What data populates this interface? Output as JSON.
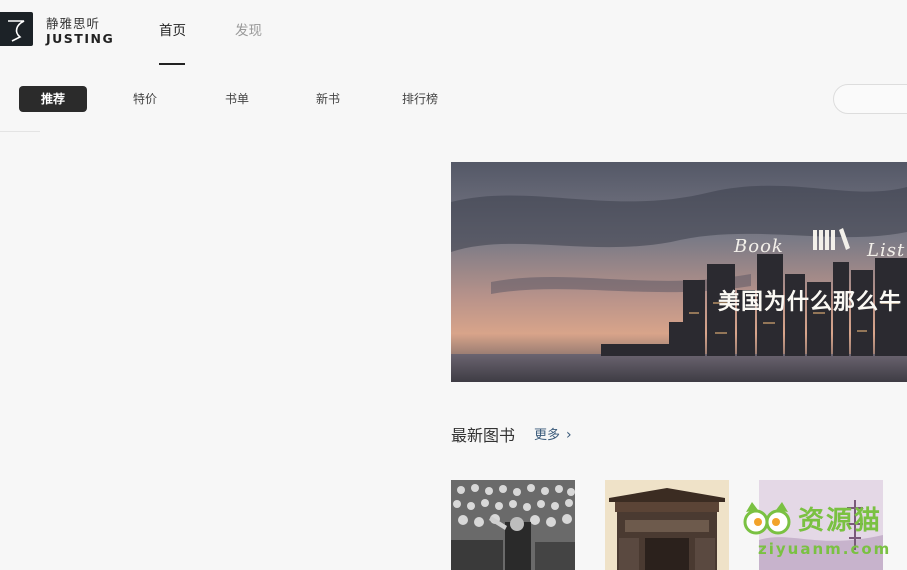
{
  "brand": {
    "name_cn": "静雅思听",
    "name_en": "JUSTING"
  },
  "nav": {
    "tabs": [
      {
        "label": "首页",
        "active": true
      },
      {
        "label": "发现",
        "active": false
      }
    ]
  },
  "categories": [
    {
      "label": "推荐",
      "active": true
    },
    {
      "label": "特价",
      "active": false
    },
    {
      "label": "书单",
      "active": false
    },
    {
      "label": "新书",
      "active": false
    },
    {
      "label": "排行榜",
      "active": false
    }
  ],
  "search": {
    "placeholder": ""
  },
  "banner": {
    "tag_left": "Book",
    "tag_right": "List",
    "title": "美国为什么那么牛"
  },
  "new_books": {
    "title": "最新图书",
    "more_label": "更多",
    "items": [
      {
        "cover": "crowd-photo"
      },
      {
        "cover": "chinese-gate-photo"
      },
      {
        "cover": "purple-calligraphy-cover"
      }
    ]
  },
  "watermark": {
    "title": "资源猫",
    "url": "ziyuanm.com"
  },
  "colors": {
    "active_tab_bg": "#2b2b2b",
    "accent_link": "#3a5a7a",
    "watermark_green": "#7ac142"
  }
}
